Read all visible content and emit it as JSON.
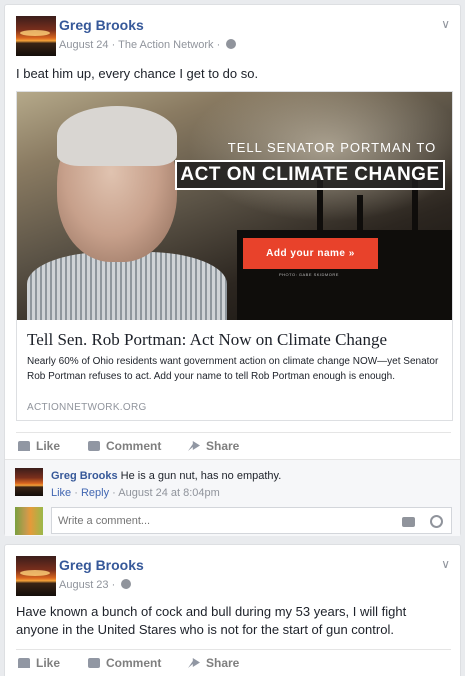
{
  "posts": [
    {
      "author": "Greg Brooks",
      "date": "August 24",
      "separator": "·",
      "source": "The Action Network",
      "text": "I beat him up, every chance I get to do so.",
      "share": {
        "banner_title": "TELL SENATOR PORTMAN TO",
        "banner_cta": "ACT ON CLIMATE CHANGE",
        "banner_button": "Add your name »",
        "photo_credit": "PHOTO: GABE SKIDMORE",
        "title": "Tell Sen. Rob Portman: Act Now on Climate Change",
        "description": "Nearly 60% of Ohio residents want government action on climate change NOW—yet Senator Rob Portman refuses to act. Add your name to tell Rob Portman enough is enough.",
        "domain": "ACTIONNETWORK.ORG"
      },
      "actions": {
        "like": "Like",
        "comment": "Comment",
        "share": "Share"
      },
      "comment": {
        "author": "Greg Brooks",
        "text": "He is a gun nut, has no empathy.",
        "like": "Like",
        "reply": "Reply",
        "dot": "·",
        "timestamp": "August 24 at 8:04pm"
      },
      "comment_placeholder": "Write a comment..."
    },
    {
      "author": "Greg Brooks",
      "date": "August 23",
      "separator": "·",
      "text": "Have known a bunch of cock and bull during my 53 years, I will fight anyone in the United Stares who is not for the start of gun control.",
      "actions": {
        "like": "Like",
        "comment": "Comment",
        "share": "Share"
      }
    }
  ],
  "icons": {
    "chevron": "chevron-down-icon",
    "globe": "globe-icon",
    "like": "thumbs-up-icon",
    "comment": "speech-bubble-icon",
    "share": "share-arrow-icon",
    "camera": "camera-icon",
    "smile": "emoji-icon"
  },
  "colors": {
    "link": "#365899",
    "cta": "#e8422b",
    "background": "#e9ebee"
  }
}
